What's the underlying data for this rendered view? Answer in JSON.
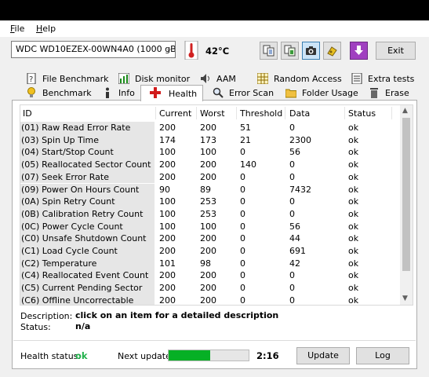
{
  "menu": {
    "file": "File",
    "help": "Help"
  },
  "toolbar": {
    "drive": "WDC WD10EZEX-00WN4A0 (1000 gB)",
    "temperature": "42°C",
    "exit_label": "Exit",
    "buttons": [
      "copy-text-icon",
      "copy-info-icon",
      "screenshot-icon",
      "options-icon",
      "download-icon"
    ]
  },
  "tabs": {
    "row1": [
      "File Benchmark",
      "Disk monitor",
      "AAM",
      "Random Access",
      "Extra tests"
    ],
    "row2": [
      "Benchmark",
      "Info",
      "Health",
      "Error Scan",
      "Folder Usage",
      "Erase"
    ],
    "active": "Health"
  },
  "table": {
    "headers": [
      "ID",
      "Current",
      "Worst",
      "Threshold",
      "Data",
      "Status"
    ],
    "rows": [
      [
        "(01) Raw Read Error Rate",
        "200",
        "200",
        "51",
        "0",
        "ok"
      ],
      [
        "(03) Spin Up Time",
        "174",
        "173",
        "21",
        "2300",
        "ok"
      ],
      [
        "(04) Start/Stop Count",
        "100",
        "100",
        "0",
        "56",
        "ok"
      ],
      [
        "(05) Reallocated Sector Count",
        "200",
        "200",
        "140",
        "0",
        "ok"
      ],
      [
        "(07) Seek Error Rate",
        "200",
        "200",
        "0",
        "0",
        "ok"
      ],
      [
        "(09) Power On Hours Count",
        "90",
        "89",
        "0",
        "7432",
        "ok"
      ],
      [
        "(0A) Spin Retry Count",
        "100",
        "253",
        "0",
        "0",
        "ok"
      ],
      [
        "(0B) Calibration Retry Count",
        "100",
        "253",
        "0",
        "0",
        "ok"
      ],
      [
        "(0C) Power Cycle Count",
        "100",
        "100",
        "0",
        "56",
        "ok"
      ],
      [
        "(C0) Unsafe Shutdown Count",
        "200",
        "200",
        "0",
        "44",
        "ok"
      ],
      [
        "(C1) Load Cycle Count",
        "200",
        "200",
        "0",
        "691",
        "ok"
      ],
      [
        "(C2) Temperature",
        "101",
        "98",
        "0",
        "42",
        "ok"
      ],
      [
        "(C4) Reallocated Event Count",
        "200",
        "200",
        "0",
        "0",
        "ok"
      ],
      [
        "(C5) Current Pending Sector",
        "200",
        "200",
        "0",
        "0",
        "ok"
      ],
      [
        "(C6) Offline Uncorrectable",
        "200",
        "200",
        "0",
        "0",
        "ok"
      ]
    ]
  },
  "description": {
    "desc_label": "Description:",
    "desc_value": "click on an item for a detailed description",
    "status_label": "Status:",
    "status_value": "n/a"
  },
  "footer": {
    "health_label": "Health status:",
    "health_value": "ok",
    "next_update_label": "Next update:",
    "progress_percent": 52,
    "countdown": "2:16",
    "update_label": "Update",
    "log_label": "Log"
  },
  "colors": {
    "ok_green": "#22b14c",
    "progress_green": "#06b025"
  }
}
